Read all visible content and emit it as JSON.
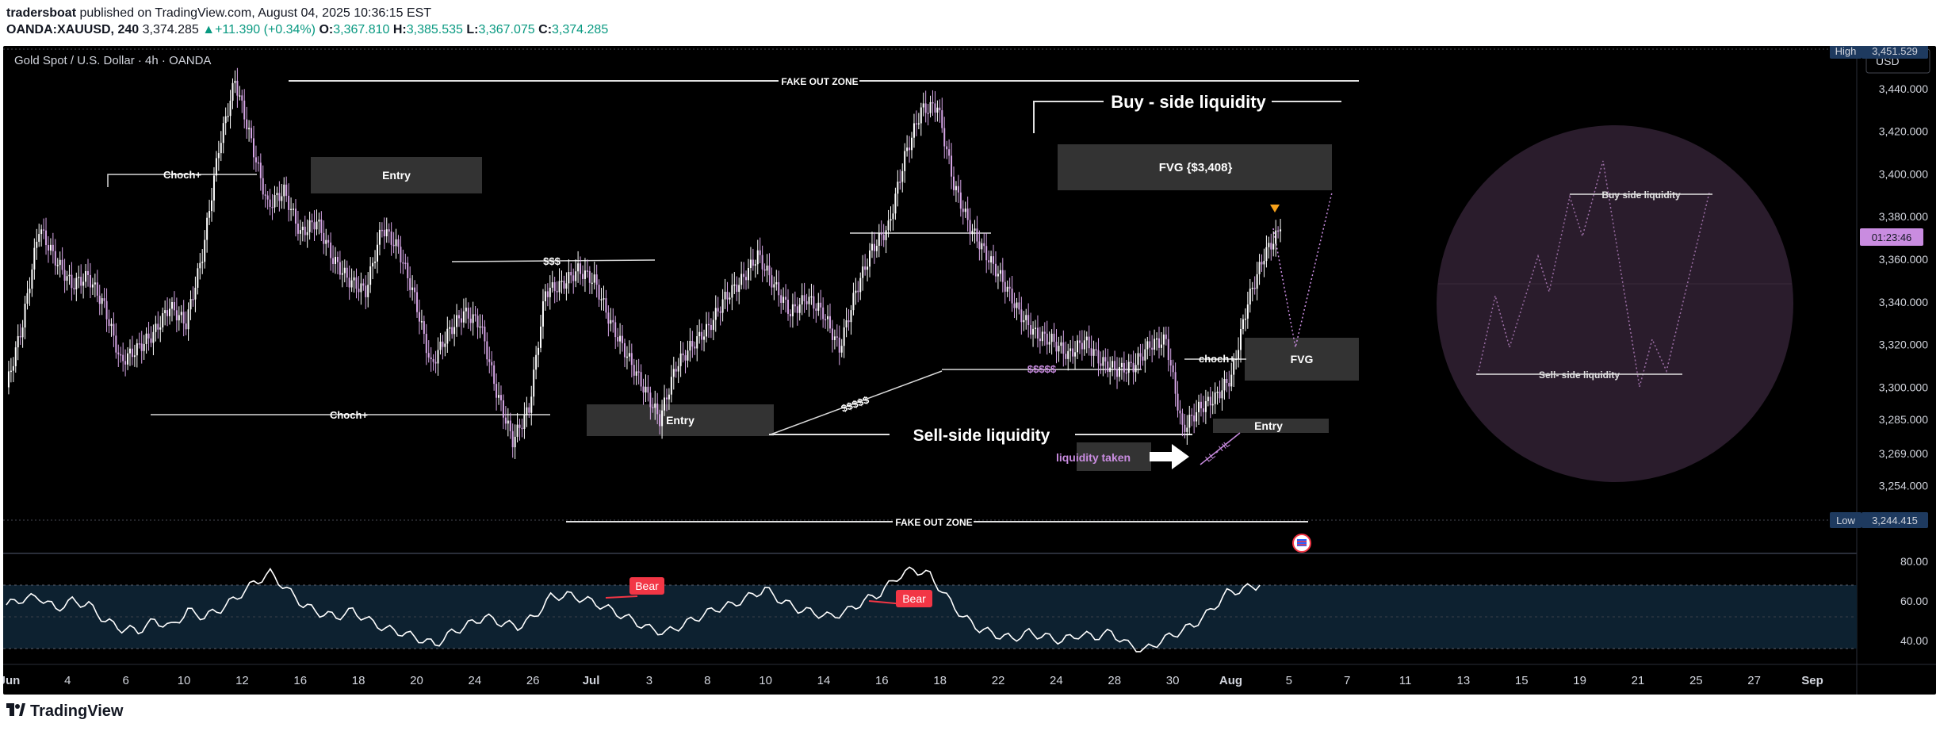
{
  "header": {
    "author": "tradersboat",
    "published": "published on TradingView.com, August 04, 2025 10:36:15 EST",
    "symbol": "OANDA:XAUUSD, 240",
    "last": "3,374.285",
    "change": "+11.390 (+0.34%)",
    "o_label": "O:",
    "o_value": "3,367.810",
    "h_label": "H:",
    "h_value": "3,385.535",
    "l_label": "L:",
    "l_value": "3,367.075",
    "c_label": "C:",
    "c_value": "3,374.285"
  },
  "chart": {
    "instrument": "Gold Spot / U.S. Dollar · 4h · OANDA",
    "currency_button": "USD",
    "high_label": "High",
    "high_value": "3,451.529",
    "low_label": "Low",
    "low_value": "3,244.415",
    "countdown": "01:23:46",
    "annotations": {
      "fake_out_top": "FAKE OUT ZONE",
      "fake_out_bottom": "FAKE OUT ZONE",
      "buy_side": "Buy - side liquidity",
      "sell_side": "Sell-side liquidity",
      "fvg_top": "FVG {$3,408}",
      "fvg_right": "FVG",
      "entry1": "Entry",
      "entry2": "Entry",
      "entry3": "Entry",
      "choch1": "Choch+",
      "choch2": "Choch+",
      "choch3": "choch+",
      "dollars1": "$$$",
      "dollars2": "$$$$$",
      "dollars3": "$$$$$",
      "liquidity_taken": "liquidity taken",
      "ll_hl": "LL - HL",
      "circle_buy": "Buy side liquidity",
      "circle_sell": "Sell- side liquidity"
    },
    "rsi_badges": [
      "Bear",
      "Bear"
    ]
  },
  "footer": {
    "brand": "TradingView"
  },
  "chart_data": [
    {
      "type": "candlestick",
      "title": "Gold Spot / U.S. Dollar · 4h · OANDA",
      "y_ticks": [
        3440,
        3420,
        3400,
        3380,
        3360,
        3340,
        3320,
        3300,
        3285,
        3269,
        3254
      ],
      "y_tick_labels": [
        "3,440.000",
        "3,420.000",
        "3,400.000",
        "3,380.000",
        "3,360.000",
        "3,340.000",
        "3,320.000",
        "3,300.000",
        "3,285.000",
        "3,269.000",
        "3,254.000"
      ],
      "ylim": [
        3237,
        3460
      ],
      "x_tick_labels": [
        "Jun",
        "4",
        "6",
        "10",
        "12",
        "16",
        "18",
        "20",
        "24",
        "26",
        "Jul",
        "3",
        "8",
        "10",
        "14",
        "16",
        "18",
        "22",
        "24",
        "28",
        "30",
        "Aug",
        "5",
        "7",
        "11",
        "13",
        "15",
        "19",
        "21",
        "25",
        "27",
        "Sep"
      ],
      "current_price": 3374.285,
      "high": 3451.529,
      "low": 3244.415,
      "close_path": [
        3300,
        3330,
        3375,
        3360,
        3348,
        3352,
        3338,
        3312,
        3318,
        3325,
        3338,
        3330,
        3362,
        3412,
        3444,
        3415,
        3385,
        3392,
        3372,
        3378,
        3360,
        3350,
        3345,
        3375,
        3365,
        3342,
        3310,
        3325,
        3335,
        3330,
        3298,
        3275,
        3290,
        3345,
        3348,
        3355,
        3350,
        3330,
        3315,
        3300,
        3285,
        3310,
        3320,
        3328,
        3342,
        3350,
        3362,
        3348,
        3335,
        3342,
        3335,
        3318,
        3345,
        3365,
        3375,
        3408,
        3430,
        3432,
        3395,
        3375,
        3362,
        3350,
        3335,
        3325,
        3322,
        3315,
        3322,
        3312,
        3308,
        3310,
        3320,
        3322,
        3280,
        3290,
        3295,
        3305,
        3340,
        3362,
        3374
      ]
    },
    {
      "type": "line",
      "title": "RSI",
      "y_ticks": [
        80,
        60,
        40
      ],
      "y_tick_labels": [
        "80.00",
        "60.00",
        "40.00"
      ],
      "ylim": [
        28,
        84
      ],
      "values": [
        58,
        61,
        62,
        56,
        60,
        58,
        50,
        46,
        45,
        50,
        47,
        55,
        52,
        56,
        62,
        69,
        74,
        66,
        58,
        54,
        52,
        55,
        50,
        46,
        44,
        41,
        38,
        44,
        48,
        52,
        49,
        47,
        52,
        62,
        63,
        61,
        58,
        54,
        50,
        46,
        44,
        48,
        52,
        56,
        58,
        62,
        66,
        60,
        56,
        54,
        52,
        55,
        60,
        64,
        72,
        76,
        73,
        62,
        52,
        46,
        43,
        41,
        44,
        42,
        40,
        43,
        42,
        44,
        38,
        35,
        40,
        44,
        48,
        55,
        64,
        66,
        68
      ]
    }
  ]
}
